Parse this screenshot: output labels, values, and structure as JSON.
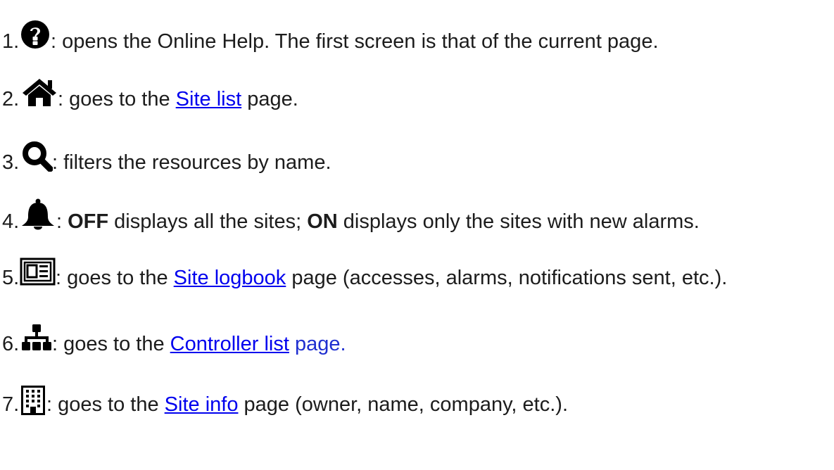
{
  "items": [
    {
      "num": "1.",
      "icon": "question-circle-icon",
      "pre": ": opens the Online Help. The first screen is that of the current page."
    },
    {
      "num": "2.",
      "icon": "home-icon",
      "pre": ": goes to the ",
      "link": "Site list",
      "post": " page."
    },
    {
      "num": "3.",
      "icon": "search-icon",
      "pre": ": filters the resources by name."
    },
    {
      "num": "4.",
      "icon": "bell-icon",
      "pre": ": ",
      "bold1": "OFF",
      "mid": " displays all the sites; ",
      "bold2": "ON",
      "post": " displays only the sites with new alarms."
    },
    {
      "num": "5.",
      "icon": "newspaper-icon",
      "pre": ": goes to the ",
      "link": "Site logbook",
      "post": " page (accesses, alarms, notifications sent, etc.)."
    },
    {
      "num": "6.",
      "icon": "sitemap-icon",
      "pre": ": goes to the ",
      "link": "Controller list",
      "post": "page."
    },
    {
      "num": "7.",
      "icon": "building-icon",
      "pre": ": goes to the ",
      "link": "Site info",
      "post": " page (owner, name, company, etc.)."
    }
  ],
  "colors": {
    "text": "#1c1c1c",
    "link": "#0000ee",
    "blue_text": "#1f2fd0",
    "icon": "#000000"
  }
}
